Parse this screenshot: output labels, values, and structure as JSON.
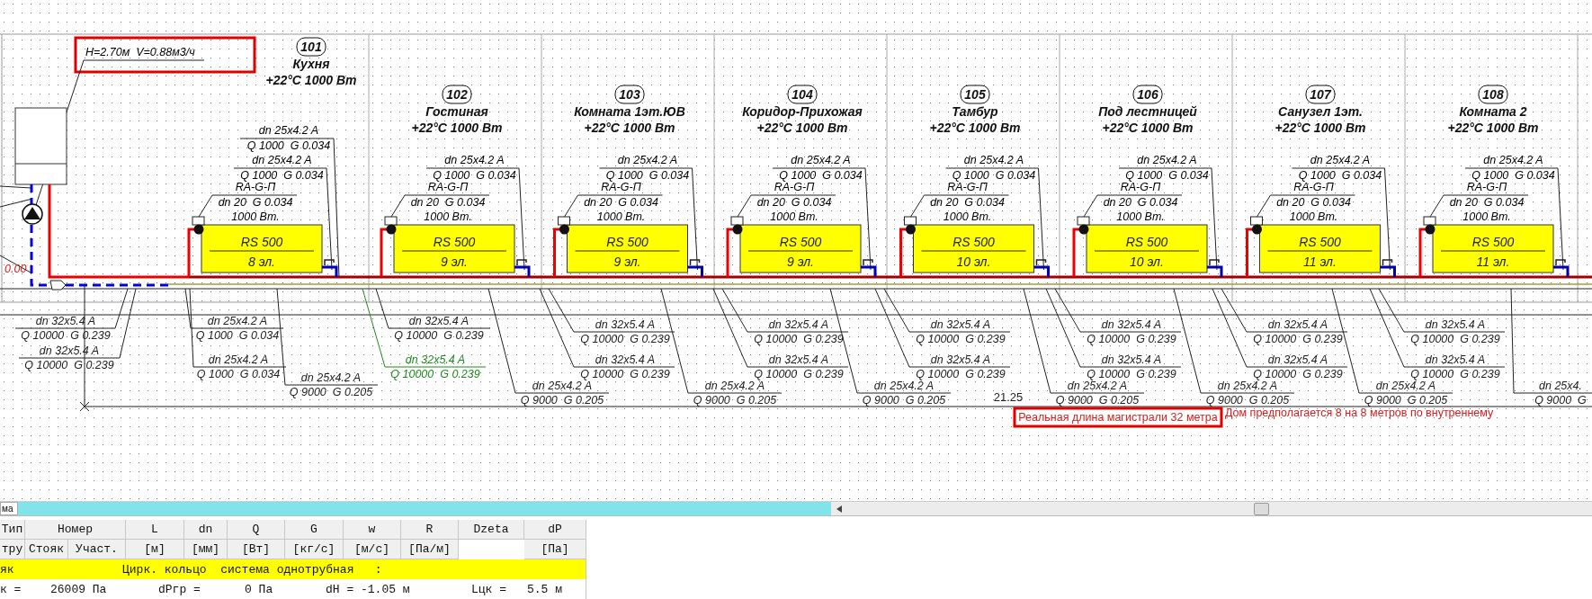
{
  "pump_annotation": {
    "text": "H=2.70м  V=0.88м3/ч"
  },
  "elevation_label": "0.00",
  "rooms": [
    {
      "number": "101",
      "name": "Кухня",
      "heat": "+22°C 1000 Вт",
      "pipe_labels": [
        {
          "dn": "dn 25x4.2 A",
          "flow": "Q 1000  G 0.034"
        },
        {
          "dn": "dn 25x4.2 A",
          "flow": "Q 1000  G 0.034"
        }
      ],
      "valve": {
        "type": "RA-G-П",
        "spec": "dn 20  G 0.034",
        "power": "1000 Вт."
      },
      "radiator": {
        "model": "RS 500",
        "sections": "8 эл."
      }
    },
    {
      "number": "102",
      "name": "Гостиная",
      "heat": "+22°C 1000 Вт",
      "pipe_labels": [
        {
          "dn": "dn 25x4.2 A",
          "flow": "Q 1000  G 0.034"
        }
      ],
      "valve": {
        "type": "RA-G-П",
        "spec": "dn 20  G 0.034",
        "power": "1000 Вт."
      },
      "radiator": {
        "model": "RS 500",
        "sections": "9 эл."
      }
    },
    {
      "number": "103",
      "name": "Комната 1эт.ЮВ",
      "heat": "+22°C 1000 Вт",
      "pipe_labels": [
        {
          "dn": "dn 25x4.2 A",
          "flow": "Q 1000  G 0.034"
        }
      ],
      "valve": {
        "type": "RA-G-П",
        "spec": "dn 20  G 0.034",
        "power": "1000 Вт."
      },
      "radiator": {
        "model": "RS 500",
        "sections": "9 эл."
      }
    },
    {
      "number": "104",
      "name": "Коридор-Прихожая",
      "heat": "+22°C 1000 Вт",
      "pipe_labels": [
        {
          "dn": "dn 25x4.2 A",
          "flow": "Q 1000  G 0.034"
        }
      ],
      "valve": {
        "type": "RA-G-П",
        "spec": "dn 20  G 0.034",
        "power": "1000 Вт."
      },
      "radiator": {
        "model": "RS 500",
        "sections": "9 эл."
      }
    },
    {
      "number": "105",
      "name": "Тамбур",
      "heat": "+22°C 1000 Вт",
      "pipe_labels": [
        {
          "dn": "dn 25x4.2 A",
          "flow": "Q 1000  G 0.034"
        }
      ],
      "valve": {
        "type": "RA-G-П",
        "spec": "dn 20  G 0.034",
        "power": "1000 Вт."
      },
      "radiator": {
        "model": "RS 500",
        "sections": "10 эл."
      }
    },
    {
      "number": "106",
      "name": "Под лестницей",
      "heat": "+22°C 1000 Вт",
      "pipe_labels": [
        {
          "dn": "dn 25x4.2 A",
          "flow": "Q 1000  G 0.034"
        }
      ],
      "valve": {
        "type": "RA-G-П",
        "spec": "dn 20  G 0.034",
        "power": "1000 Вт."
      },
      "radiator": {
        "model": "RS 500",
        "sections": "10 эл."
      }
    },
    {
      "number": "107",
      "name": "Санузел 1эт.",
      "heat": "+22°C 1000 Вт",
      "pipe_labels": [
        {
          "dn": "dn 25x4.2 A",
          "flow": "Q 1000  G 0.034"
        }
      ],
      "valve": {
        "type": "RA-G-П",
        "spec": "dn 20  G 0.034",
        "power": "1000 Вт."
      },
      "radiator": {
        "model": "RS 500",
        "sections": "11 эл."
      }
    },
    {
      "number": "108",
      "name": "Комната 2",
      "heat": "+22°C 1000 Вт",
      "pipe_labels": [
        {
          "dn": "dn 25x4.2 A",
          "flow": "Q 1000  G 0.034"
        }
      ],
      "valve": {
        "type": "RA-G-П",
        "spec": "dn 20  G 0.034",
        "power": "1000 Вт."
      },
      "radiator": {
        "model": "RS 500",
        "sections": "11 эл."
      }
    }
  ],
  "main_pipe_labels": [
    {
      "dn": "dn 32x5.4 A",
      "flow": "Q 10000  G 0.239",
      "selected": false
    },
    {
      "dn": "dn 32x5.4 A",
      "flow": "Q 10000  G 0.239",
      "selected": false
    },
    {
      "dn": "dn 25x4.2 A",
      "flow": "Q 1000  G 0.034",
      "selected": false
    },
    {
      "dn": "dn 25x4.2 A",
      "flow": "Q 1000  G 0.034",
      "selected": false
    },
    {
      "dn": "dn 25x4.2 A",
      "flow": "Q 9000  G 0.205",
      "selected": false
    },
    {
      "dn": "dn 32x5.4 A",
      "flow": "Q 10000  G 0.239",
      "selected": false
    },
    {
      "dn": "dn 32x5.4 A",
      "flow": "Q 10000  G 0.239",
      "selected": true
    },
    {
      "dn": "dn 25x4.2 A",
      "flow": "Q 9000  G 0.205",
      "selected": false
    },
    {
      "dn": "dn 32x5.4 A",
      "flow": "Q 10000  G 0.239",
      "selected": false
    },
    {
      "dn": "dn 32x5.4 A",
      "flow": "Q 10000  G 0.239",
      "selected": false
    },
    {
      "dn": "dn 25x4.2 A",
      "flow": "Q 9000  G 0.205",
      "selected": false
    },
    {
      "dn": "dn 32x5.4 A",
      "flow": "Q 10000  G 0.239",
      "selected": false
    },
    {
      "dn": "dn 32x5.4 A",
      "flow": "Q 10000  G 0.239",
      "selected": false
    },
    {
      "dn": "dn 25x4.2 A",
      "flow": "Q 9000  G 0.205",
      "selected": false
    },
    {
      "dn": "dn 32x5.4 A",
      "flow": "Q 10000  G 0.239",
      "selected": false
    },
    {
      "dn": "dn 32x5.4 A",
      "flow": "Q 10000  G 0.239",
      "selected": false
    },
    {
      "dn": "dn 25x4.2 A",
      "flow": "Q 9000  G 0.205",
      "selected": false
    },
    {
      "dn": "dn 32x5.4 A",
      "flow": "Q 10000  G 0.239",
      "selected": false
    },
    {
      "dn": "dn 32x5.4 A",
      "flow": "Q 10000  G 0.239",
      "selected": false
    },
    {
      "dn": "dn 25x4.2 A",
      "flow": "Q 9000  G 0.205",
      "selected": false
    },
    {
      "dn": "dn 32x5.4 A",
      "flow": "Q 10000  G 0.239",
      "selected": false
    },
    {
      "dn": "dn 32x5.4 A",
      "flow": "Q 10000  G 0.239",
      "selected": false
    },
    {
      "dn": "dn 25x4.2 A",
      "flow": "Q 9000  G 0.205",
      "selected": false
    },
    {
      "dn": "dn 32x5.4 A",
      "flow": "Q 10000  G 0.239",
      "selected": false
    },
    {
      "dn": "dn 32x5.4 A",
      "flow": "Q 10000  G 0.239",
      "selected": false
    },
    {
      "dn": "dn 25x4.",
      "flow": "Q 9000  G",
      "selected": false
    }
  ],
  "dimension": "21.25",
  "notes": [
    {
      "text": "Реальная длина магистрали 32 метра",
      "boxed": true
    },
    {
      "text": "Дом предполагается 8 на 8 метров по внутреннему",
      "boxed": false
    }
  ],
  "sheet_tab": {
    "label": "ма"
  },
  "table": {
    "header_row_1": [
      "Тип",
      "Номер",
      "L",
      "dn",
      "Q",
      "G",
      "w",
      "R",
      "Dzeta",
      "dP"
    ],
    "header_row_2": [
      "тру",
      "Стояк",
      "Участ.",
      "[м]",
      "[мм]",
      "[Вт]",
      "[кг/с]",
      "[м/с]",
      "[Па/м]",
      "[Па]"
    ],
    "ring_row": [
      "як",
      "Цирк. кольцо  система однотрубная   :"
    ],
    "summary_row": [
      "к =",
      "26009 Па",
      "dPгр =",
      "0 Па",
      "dH = -1.05 м",
      "Lцк =",
      "5.5 м"
    ]
  }
}
